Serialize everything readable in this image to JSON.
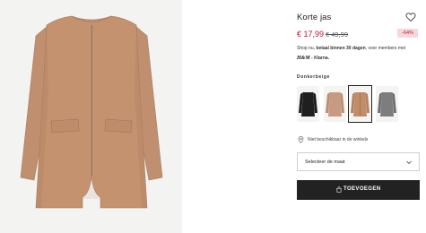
{
  "product": {
    "title": "Korte jas",
    "price_current": "€ 17,99",
    "price_original": "€ 49,99",
    "discount": "-64%",
    "shop_now_prefix": "Shop nu, ",
    "shop_now_bold": "betaal binnen 30 dagen",
    "shop_now_suffix": ", voor members met",
    "klarna_brand": "H&M",
    "klarna_suffix": " - Klarna.",
    "color_label": "Donkerbeige",
    "swatches": [
      {
        "name": "black",
        "color": "#1f1f1f"
      },
      {
        "name": "light-beige",
        "color": "#c79a82"
      },
      {
        "name": "dark-beige",
        "color": "#c18c68",
        "selected": true
      },
      {
        "name": "grey-melange",
        "color": "#7d7d7d"
      }
    ],
    "availability": "Niet beschikbaar in de winkels",
    "size_placeholder": "Selecteer de maat",
    "add_to_cart": "TOEVOEGEN"
  },
  "colors": {
    "coat": "#c29172",
    "accent_red": "#c2142d",
    "button_bg": "#222222"
  },
  "icons": {
    "favorite": "heart-icon",
    "location": "location-pin-icon",
    "dropdown": "chevron-down-icon",
    "bag": "shopping-bag-icon"
  }
}
